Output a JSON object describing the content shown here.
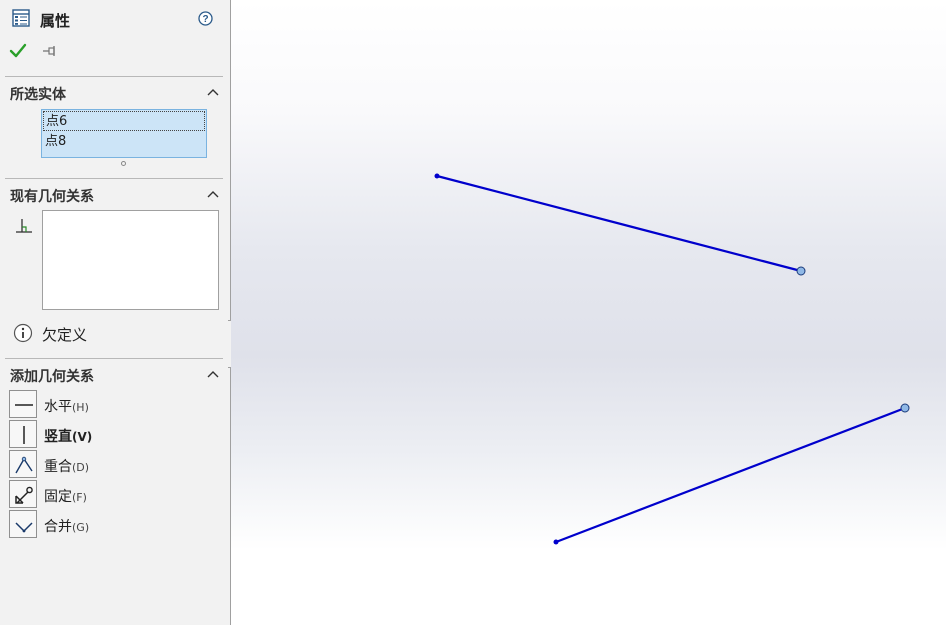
{
  "panel": {
    "title": "属性",
    "selected_entities": {
      "title": "所选实体",
      "items": [
        "点6",
        "点8"
      ]
    },
    "existing_relations": {
      "title": "现有几何关系",
      "items": []
    },
    "status_text": "欠定义",
    "add_relations": {
      "title": "添加几何关系",
      "items": [
        {
          "label": "水平",
          "hotkey": "(H)",
          "icon": "horizontal-icon"
        },
        {
          "label": "竖直",
          "hotkey": "(V)",
          "icon": "vertical-icon"
        },
        {
          "label": "重合",
          "hotkey": "(D)",
          "icon": "coincident-icon"
        },
        {
          "label": "固定",
          "hotkey": "(F)",
          "icon": "fix-icon"
        },
        {
          "label": "合并",
          "hotkey": "(G)",
          "icon": "merge-icon"
        }
      ]
    }
  },
  "colors": {
    "sketch_line": "#0000cc",
    "selected_point": "#8fb8e6",
    "list_selection": "#cce4f7",
    "ok_check": "#2aa02a"
  }
}
